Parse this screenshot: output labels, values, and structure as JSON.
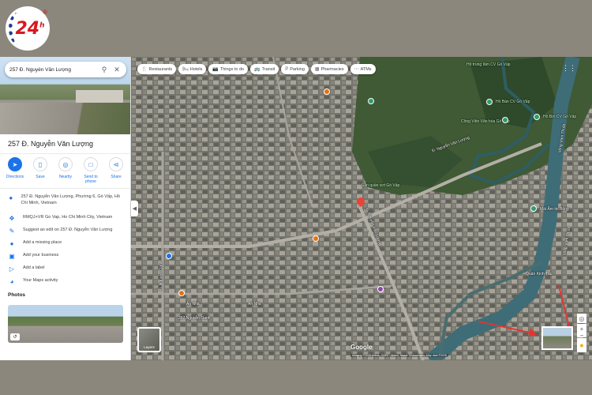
{
  "brand": {
    "logo_text": "24",
    "logo_sup": "h",
    "logo_reg": "®"
  },
  "search": {
    "query": "257 Đ. Nguyễn Văn Lượng",
    "search_icon": "search-icon",
    "close_icon": "close-icon"
  },
  "place": {
    "title": "257 Đ. Nguyễn Văn Lượng"
  },
  "actions": [
    {
      "label": "Directions",
      "icon": "directions-icon"
    },
    {
      "label": "Save",
      "icon": "bookmark-icon"
    },
    {
      "label": "Nearby",
      "icon": "nearby-icon"
    },
    {
      "label": "Send to phone",
      "icon": "phone-icon"
    },
    {
      "label": "Share",
      "icon": "share-icon"
    }
  ],
  "info": [
    {
      "text": "257 Đ. Nguyễn Văn Lượng, Phường 6, Gò Vấp, Hồ Chí Minh, Vietnam",
      "icon": "location-icon"
    },
    {
      "text": "RMQJ+VR Go Vap, Ho Chi Minh City, Vietnam",
      "icon": "plus-code-icon"
    },
    {
      "text": "Suggest an edit on 257 Đ. Nguyễn Văn Lượng",
      "icon": "edit-icon"
    },
    {
      "text": "Add a missing place",
      "icon": "add-place-icon"
    },
    {
      "text": "Add your business",
      "icon": "business-icon"
    },
    {
      "text": "Add a label",
      "icon": "label-icon"
    },
    {
      "text": "Your Maps activity",
      "icon": "history-icon"
    }
  ],
  "photos": {
    "heading": "Photos"
  },
  "chips": [
    {
      "label": "Restaurants",
      "icon": "🍴"
    },
    {
      "label": "Hotels",
      "icon": "🛏"
    },
    {
      "label": "Things to do",
      "icon": "📷"
    },
    {
      "label": "Transit",
      "icon": "🚌"
    },
    {
      "label": "Parking",
      "icon": "P"
    },
    {
      "label": "Pharmacies",
      "icon": "▦"
    },
    {
      "label": "ATMs",
      "icon": "⋯"
    }
  ],
  "map_labels": {
    "label_1": "Hồ trung tâm CV Gò Vấp",
    "label_2": "Hồ Bàn CV Gò Vấp",
    "label_3": "Công Viên Văn hóa Gò Vấp",
    "label_4": "Hồ Bơi CV Gò Vấp",
    "label_5": "Đ. Nguyễn Văn Lượng",
    "label_6": "Sân quần vợt Gò Vấp",
    "label_7": "sông Vàm Thuật",
    "label_8": "Mái Ấm tin Bông",
    "label_9": "Quán Kinh Tàu",
    "label_10": "Ản Nhà",
    "label_11": "Ản Nhà",
    "label_12": "257 Nguyễn Oanh",
    "label_13": "Đ. Nguyễn Oanh",
    "label_14": "Đ. Nguyễn Văn Lượng",
    "label_15": "sông Vàm Thuật"
  },
  "map_ui": {
    "layers_label": "Layers",
    "google": "Google",
    "attribution": "Imagery ©2025 Airbus, CNES / Airbus, Maxar Technologies, Map data ©2025"
  },
  "colors": {
    "pin": "#ea4335",
    "accent": "#1a73e8",
    "park_poi": "#2e9d6b",
    "food_poi": "#e8710a",
    "shop_poi": "#8e44ad",
    "arrow": "#e8332c"
  }
}
